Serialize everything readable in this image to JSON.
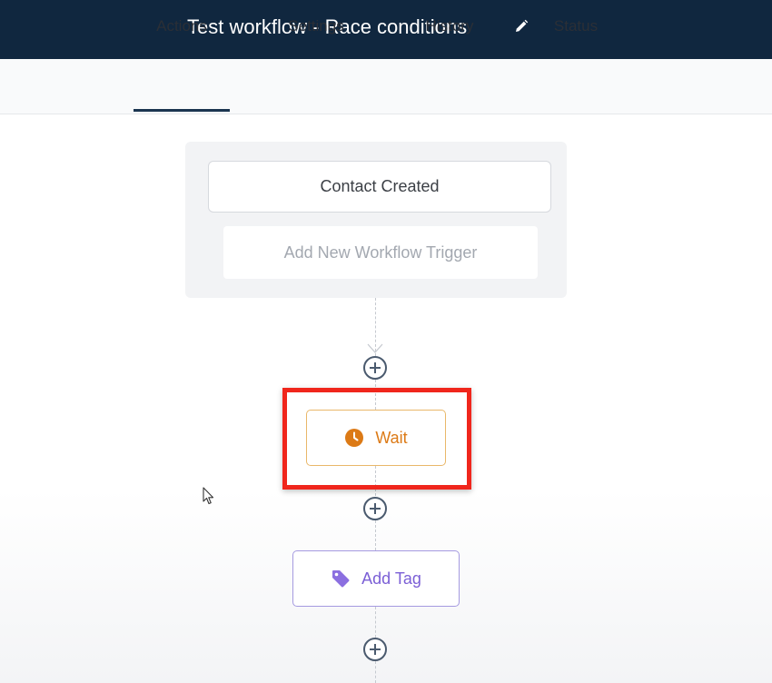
{
  "header": {
    "title": "Test workflow - Race conditions",
    "edit_icon": "pencil-icon",
    "background": "#10273f"
  },
  "tabs": [
    {
      "label": "Actions",
      "active": true
    },
    {
      "label": "Settings",
      "active": false
    },
    {
      "label": "History",
      "active": false
    },
    {
      "label": "Status",
      "active": false
    }
  ],
  "workflow": {
    "trigger": {
      "label": "Contact Created"
    },
    "add_trigger": {
      "label": "Add New Workflow Trigger"
    },
    "steps": [
      {
        "label": "Wait",
        "icon": "clock-icon",
        "color": "#dc7a16",
        "highlighted": true
      },
      {
        "label": "Add Tag",
        "icon": "tag-icon",
        "color": "#7b5fd6",
        "highlighted": false
      }
    ],
    "add_step_icon": "plus-circle-icon",
    "highlight_color": "#f0261c"
  }
}
